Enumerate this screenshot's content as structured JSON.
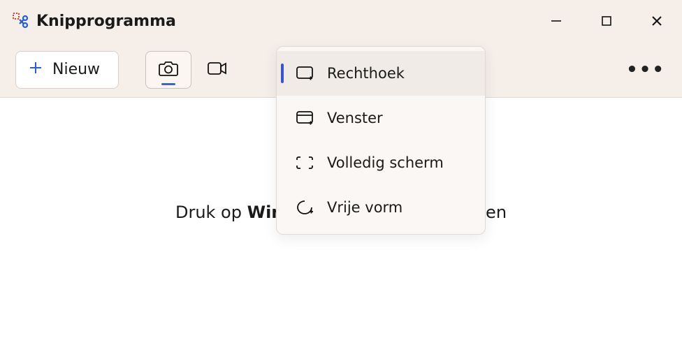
{
  "app": {
    "title": "Knipprogramma"
  },
  "toolbar": {
    "new_label": "Nieuw"
  },
  "menu": {
    "items": [
      {
        "label": "Rechthoek"
      },
      {
        "label": "Venster"
      },
      {
        "label": "Volledig scherm"
      },
      {
        "label": "Vrije vorm"
      }
    ]
  },
  "hint": {
    "prefix": "Druk op ",
    "bold": "Windows-logo",
    "suffix": "ipsel te starten"
  }
}
